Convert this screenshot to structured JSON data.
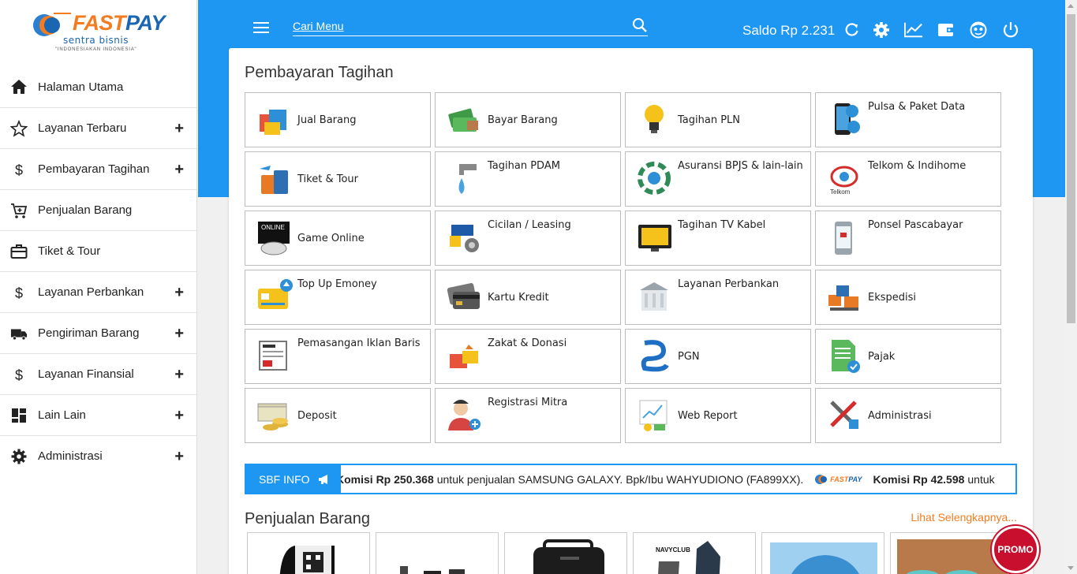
{
  "sidebar": {
    "logo": {
      "brand_a": "FAST",
      "brand_b": "PAY",
      "tagline": "sentra bisnis",
      "tagline2": "\"INDONESIAKAN INDONESIA\""
    },
    "items": [
      {
        "label": "Halaman Utama",
        "icon": "home-icon",
        "expand": ""
      },
      {
        "label": "Layanan Terbaru",
        "icon": "star-icon",
        "expand": "+"
      },
      {
        "label": "Pembayaran Tagihan",
        "icon": "dollar-icon",
        "expand": "+"
      },
      {
        "label": "Penjualan Barang",
        "icon": "cart-icon",
        "expand": ""
      },
      {
        "label": "Tiket & Tour",
        "icon": "briefcase-icon",
        "expand": ""
      },
      {
        "label": "Layanan Perbankan",
        "icon": "dollar-icon",
        "expand": "+"
      },
      {
        "label": "Pengiriman Barang",
        "icon": "truck-icon",
        "expand": "+"
      },
      {
        "label": "Layanan Finansial",
        "icon": "dollar-icon",
        "expand": "+"
      },
      {
        "label": "Lain Lain",
        "icon": "dashboard-icon",
        "expand": "+"
      },
      {
        "label": "Administrasi",
        "icon": "gear-icon",
        "expand": "+"
      }
    ]
  },
  "topbar": {
    "search_placeholder": "Cari Menu",
    "saldo": "Saldo Rp 2.231",
    "icons": [
      "refresh-icon",
      "settings-icon",
      "chart-icon",
      "wallet-icon",
      "face-icon",
      "power-icon"
    ]
  },
  "main": {
    "title": "Pembayaran Tagihan",
    "tiles": [
      {
        "label": "Jual Barang",
        "icon": "jual-barang-icon",
        "color": "#e8543b"
      },
      {
        "label": "Bayar Barang",
        "icon": "bayar-barang-icon",
        "color": "#3f9a47"
      },
      {
        "label": "Tagihan PLN",
        "icon": "lightbulb-icon",
        "color": "#f4c21b"
      },
      {
        "label": "Pulsa & Paket Data",
        "icon": "phone-icon",
        "color": "#2d8fd5",
        "top": true
      },
      {
        "label": "Tiket & Tour",
        "icon": "luggage-icon",
        "color": "#e97a25"
      },
      {
        "label": "Tagihan PDAM",
        "icon": "water-tap-icon",
        "color": "#4aa3df",
        "top": true
      },
      {
        "label": "Asuransi BPJS & lain-lain",
        "icon": "bpjs-icon",
        "color": "#2e8b57",
        "top": true
      },
      {
        "label": "Telkom & Indihome",
        "icon": "telephone-icon",
        "color": "#d62b2b",
        "top": true
      },
      {
        "label": "Game Online",
        "icon": "gamepad-icon",
        "color": "#444444"
      },
      {
        "label": "Cicilan / Leasing",
        "icon": "leasing-icon",
        "color": "#1e5aa8",
        "top": true
      },
      {
        "label": "Tagihan TV Kabel",
        "icon": "tv-icon",
        "color": "#222222",
        "top": true
      },
      {
        "label": "Ponsel Pascabayar",
        "icon": "mobile-icon",
        "color": "#9aa4ad",
        "top": true
      },
      {
        "label": "Top Up Emoney",
        "icon": "emoney-icon",
        "color": "#f4c21b",
        "top": true
      },
      {
        "label": "Kartu Kredit",
        "icon": "credit-card-icon",
        "color": "#555555"
      },
      {
        "label": "Layanan Perbankan",
        "icon": "bank-icon",
        "color": "#9aa4ad",
        "top": true
      },
      {
        "label": "Ekspedisi",
        "icon": "shipping-icon",
        "color": "#e97a25"
      },
      {
        "label": "Pemasangan Iklan Baris",
        "icon": "newspaper-icon",
        "color": "#777777",
        "top": true
      },
      {
        "label": "Zakat & Donasi",
        "icon": "gift-icon",
        "color": "#e8543b",
        "top": true
      },
      {
        "label": "PGN",
        "icon": "pgn-icon",
        "color": "#1f6fc4"
      },
      {
        "label": "Pajak",
        "icon": "tax-document-icon",
        "color": "#5cb85c"
      },
      {
        "label": "Deposit",
        "icon": "money-stack-icon",
        "color": "#e0b43a"
      },
      {
        "label": "Registrasi Mitra",
        "icon": "user-add-icon",
        "color": "#d64541",
        "top": true
      },
      {
        "label": "Web Report",
        "icon": "report-icon",
        "color": "#4aa3df"
      },
      {
        "label": "Administrasi",
        "icon": "tools-icon",
        "color": "#666666"
      }
    ],
    "info": {
      "label": "SBF INFO",
      "msg1_bold": "Komisi Rp 250.368",
      "msg1_rest": "untuk penjualan SAMSUNG GALAXY. Bpk/Ibu WAHYUDIONO (FA899XX).",
      "msg2_bold": "Komisi Rp 42.598",
      "msg2_rest": "untuk"
    },
    "section2_title": "Penjualan Barang",
    "see_more": "Lihat Selengkapnya...",
    "promo": "PROMO"
  }
}
